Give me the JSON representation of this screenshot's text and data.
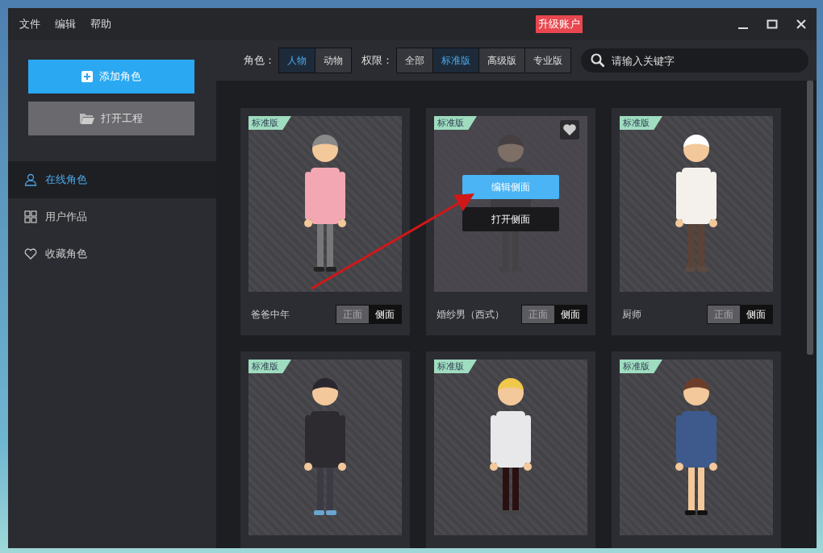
{
  "menu": [
    "文件",
    "编辑",
    "帮助"
  ],
  "upgrade_badge": "升级账户",
  "sidebar": {
    "add_button": "添加角色",
    "open_button": "打开工程",
    "items": [
      {
        "label": "在线角色",
        "selected": true
      },
      {
        "label": "用户作品",
        "selected": false
      },
      {
        "label": "收藏角色",
        "selected": false
      }
    ]
  },
  "filters": [
    {
      "label": "角色：",
      "options": [
        {
          "label": "人物",
          "selected": true
        },
        {
          "label": "动物",
          "selected": false
        }
      ]
    },
    {
      "label": "权限：",
      "options": [
        {
          "label": "全部",
          "selected": false
        },
        {
          "label": "标准版",
          "selected": true
        },
        {
          "label": "高级版",
          "selected": false
        },
        {
          "label": "专业版",
          "selected": false
        }
      ]
    }
  ],
  "search": {
    "placeholder": "请输入关键字"
  },
  "cards": [
    {
      "tag": "标准版",
      "name": "爸爸中年",
      "hovered": false,
      "views": [
        {
          "label": "正面",
          "selected": false
        },
        {
          "label": "侧面",
          "selected": true
        }
      ]
    },
    {
      "tag": "标准版",
      "name": "婚纱男（西式）",
      "hovered": true,
      "actions": [
        "编辑侧面",
        "打开侧面"
      ],
      "views": [
        {
          "label": "正面",
          "selected": false
        },
        {
          "label": "侧面",
          "selected": true
        }
      ]
    },
    {
      "tag": "标准版",
      "name": "厨师",
      "hovered": false,
      "views": [
        {
          "label": "正面",
          "selected": false
        },
        {
          "label": "侧面",
          "selected": true
        }
      ]
    },
    {
      "tag": "标准版",
      "hovered": false
    },
    {
      "tag": "标准版",
      "hovered": false
    },
    {
      "tag": "标准版",
      "hovered": false
    }
  ]
}
